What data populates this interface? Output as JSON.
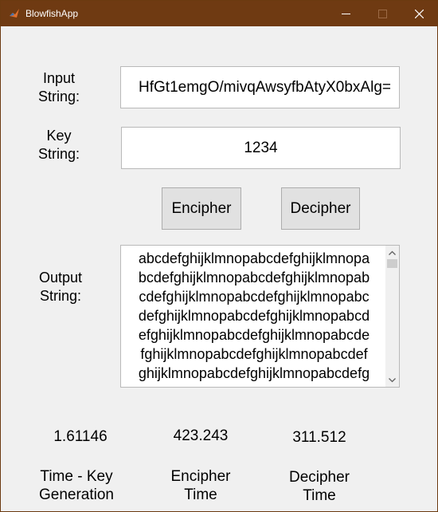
{
  "window": {
    "title": "BlowfishApp",
    "title_bar_color": "#6f3a12"
  },
  "inputs": {
    "input_label_line1": "Input",
    "input_label_line2": "String:",
    "input_value": "HfGt1emgO/mivqAwsyfbAtyX0bxAlg=",
    "key_label_line1": "Key",
    "key_label_line2": "String:",
    "key_value": "1234"
  },
  "buttons": {
    "encipher": "Encipher",
    "decipher": "Decipher"
  },
  "output": {
    "label_line1": "Output",
    "label_line2": "String:",
    "lines": [
      "abcdefghijklmnopabcdefghijklmnopa",
      "bcdefghijklmnopabcdefghijklmnopab",
      "cdefghijklmnopabcdefghijklmnopabc",
      "defghijklmnopabcdefghijklmnopabcd",
      "efghijklmnopabcdefghijklmnopabcde",
      "fghijklmnopabcdefghijklmnopabcdef",
      "ghijklmnopabcdefghijklmnopabcdefg"
    ]
  },
  "timings": {
    "key_generation_value": "1.61146",
    "encipher_value": "423.243",
    "decipher_value": "311.512",
    "key_generation_label_line1": "Time - Key",
    "key_generation_label_line2": "Generation",
    "encipher_label_line1": "Encipher",
    "encipher_label_line2": "Time",
    "decipher_label_line1": "Decipher",
    "decipher_label_line2": "Time"
  }
}
